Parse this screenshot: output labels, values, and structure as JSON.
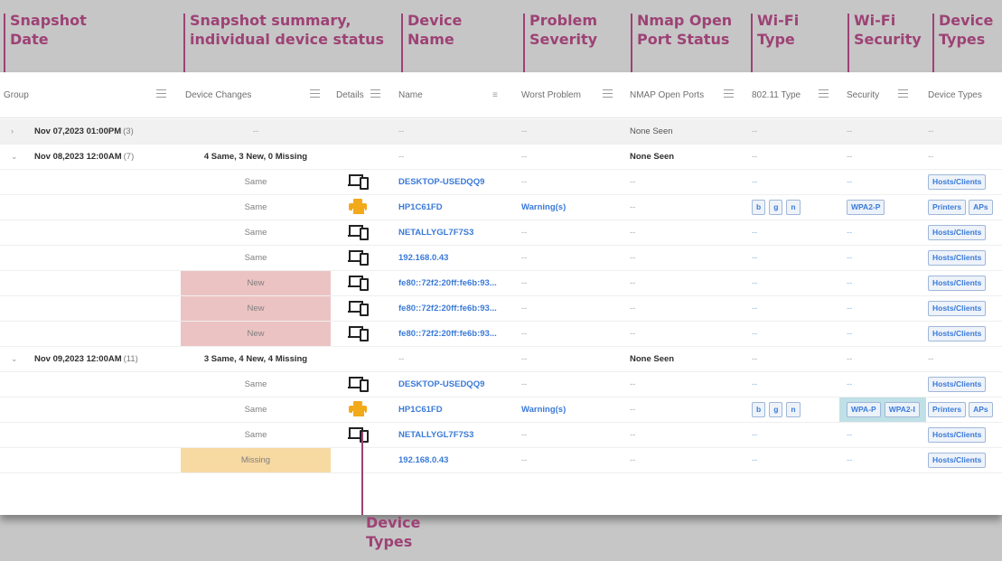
{
  "callouts": {
    "snapshot_date": [
      "Snapshot",
      "Date"
    ],
    "snapshot_summary": [
      "Snapshot summary,",
      "individual device status"
    ],
    "device_name": [
      "Device",
      "Name"
    ],
    "problem_severity": [
      "Problem",
      "Severity"
    ],
    "nmap": [
      "Nmap Open",
      "Port Status"
    ],
    "wifi_type": [
      "Wi-Fi",
      "Type"
    ],
    "wifi_security": [
      "Wi-Fi",
      "Security"
    ],
    "device_types_top": [
      "Device",
      "Types"
    ],
    "device_types_bottom": [
      "Device",
      "Types"
    ]
  },
  "columns": {
    "group": "Group",
    "changes": "Device Changes",
    "details": "Details",
    "name": "Name",
    "worst": "Worst Problem",
    "nmap": "NMAP Open Ports",
    "type80211": "802.11 Type",
    "security": "Security",
    "device_types": "Device Types"
  },
  "rows": [
    {
      "kind": "group",
      "collapsed": true,
      "date": "Nov 07,2023 01:00PM",
      "count": "(3)",
      "summary": "--",
      "name": "--",
      "worst": "--",
      "nmap": "None Seen",
      "type": "--",
      "security": "--",
      "dtypes": "--"
    },
    {
      "kind": "group",
      "collapsed": false,
      "date": "Nov 08,2023 12:00AM",
      "count": "(7)",
      "summary": "4 Same, 3 New, 0 Missing",
      "name": "--",
      "worst": "--",
      "nmap": "None Seen",
      "type": "--",
      "security": "--",
      "dtypes": "--"
    },
    {
      "kind": "device",
      "change": "Same",
      "status": "same",
      "icon": "laptop-phone-icon",
      "name": "DESKTOP-USEDQQ9",
      "worst": "--",
      "nmap": "--",
      "types80211": [],
      "type": "--",
      "security": "--",
      "sec_chips": [],
      "dtypes": [
        "Hosts/Clients"
      ]
    },
    {
      "kind": "device",
      "change": "Same",
      "status": "same",
      "icon": "printer-icon",
      "name": "HP1C61FD",
      "worst": "Warning(s)",
      "nmap": "--",
      "types80211": [
        "b",
        "g",
        "n"
      ],
      "type": "",
      "security": "",
      "sec_chips": [
        "WPA2-P"
      ],
      "dtypes": [
        "Printers",
        "APs"
      ]
    },
    {
      "kind": "device",
      "change": "Same",
      "status": "same",
      "icon": "laptop-phone-icon",
      "name": "NETALLYGL7F7S3",
      "worst": "--",
      "nmap": "--",
      "types80211": [],
      "type": "--",
      "security": "--",
      "sec_chips": [],
      "dtypes": [
        "Hosts/Clients"
      ]
    },
    {
      "kind": "device",
      "change": "Same",
      "status": "same",
      "icon": "laptop-phone-icon",
      "name": "192.168.0.43",
      "worst": "--",
      "nmap": "--",
      "types80211": [],
      "type": "--",
      "security": "--",
      "sec_chips": [],
      "dtypes": [
        "Hosts/Clients"
      ]
    },
    {
      "kind": "device",
      "change": "New",
      "status": "new",
      "icon": "laptop-phone-icon",
      "name": "fe80::72f2:20ff:fe6b:93...",
      "worst": "--",
      "nmap": "--",
      "types80211": [],
      "type": "--",
      "security": "--",
      "sec_chips": [],
      "dtypes": [
        "Hosts/Clients"
      ]
    },
    {
      "kind": "device",
      "change": "New",
      "status": "new",
      "icon": "laptop-phone-icon",
      "name": "fe80::72f2:20ff:fe6b:93...",
      "worst": "--",
      "nmap": "--",
      "types80211": [],
      "type": "--",
      "security": "--",
      "sec_chips": [],
      "dtypes": [
        "Hosts/Clients"
      ]
    },
    {
      "kind": "device",
      "change": "New",
      "status": "new",
      "icon": "laptop-phone-icon",
      "name": "fe80::72f2:20ff:fe6b:93...",
      "worst": "--",
      "nmap": "--",
      "types80211": [],
      "type": "--",
      "security": "--",
      "sec_chips": [],
      "dtypes": [
        "Hosts/Clients"
      ]
    },
    {
      "kind": "group",
      "collapsed": false,
      "date": "Nov 09,2023 12:00AM",
      "count": "(11)",
      "summary": "3 Same, 4 New, 4 Missing",
      "name": "--",
      "worst": "--",
      "nmap": "None Seen",
      "type": "--",
      "security": "--",
      "dtypes": "--"
    },
    {
      "kind": "device",
      "change": "Same",
      "status": "same",
      "icon": "laptop-phone-icon",
      "name": "DESKTOP-USEDQQ9",
      "worst": "--",
      "nmap": "--",
      "types80211": [],
      "type": "--",
      "security": "--",
      "sec_chips": [],
      "dtypes": [
        "Hosts/Clients"
      ]
    },
    {
      "kind": "device",
      "change": "Same",
      "status": "same",
      "icon": "printer-icon",
      "name": "HP1C61FD",
      "worst": "Warning(s)",
      "nmap": "--",
      "types80211": [
        "b",
        "g",
        "n"
      ],
      "type": "",
      "security": "",
      "sec_chips": [
        "WPA-P",
        "WPA2-I"
      ],
      "sec_highlight": true,
      "dtypes": [
        "Printers",
        "APs"
      ]
    },
    {
      "kind": "device",
      "change": "Same",
      "status": "same",
      "icon": "laptop-phone-icon",
      "name": "NETALLYGL7F7S3",
      "worst": "--",
      "nmap": "--",
      "types80211": [],
      "type": "--",
      "security": "--",
      "sec_chips": [],
      "dtypes": [
        "Hosts/Clients"
      ]
    },
    {
      "kind": "device",
      "change": "Missing",
      "status": "missing",
      "icon": "",
      "name": "192.168.0.43",
      "worst": "--",
      "nmap": "--",
      "types80211": [],
      "type": "--",
      "security": "--",
      "sec_chips": [],
      "dtypes": [
        "Hosts/Clients"
      ]
    }
  ]
}
